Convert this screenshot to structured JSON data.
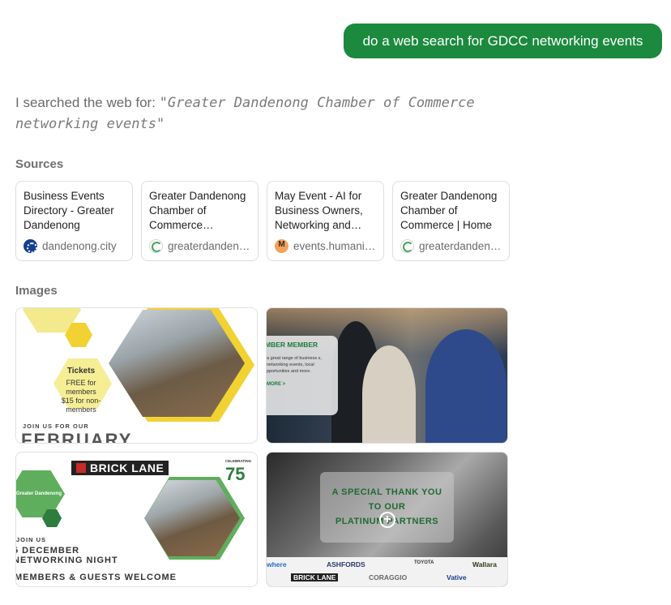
{
  "user_message": "do a web search for GDCC networking events",
  "search": {
    "prefix": "I searched the web for: ",
    "query": "\"Greater Dandenong Chamber of Commerce networking events\""
  },
  "sources": {
    "label": "Sources",
    "items": [
      {
        "title": "Business Events Directory - Greater Dandenong",
        "domain": "dandenong.city",
        "icon": "globe-icon"
      },
      {
        "title": "Greater Dandenong Chamber of Commerce…",
        "domain": "greaterdandenongchamber.com.au",
        "icon": "chamber-logo-icon"
      },
      {
        "title": "May Event - AI for Business Owners, Networking and…",
        "domain": "events.humanitix.com",
        "icon": "humanitix-icon"
      },
      {
        "title": "Greater Dandenong Chamber of Commerce | Home",
        "domain": "greaterdandenongchamber.com.au",
        "icon": "chamber-logo-icon"
      }
    ]
  },
  "images": {
    "label": "Images",
    "tiles": [
      {
        "tickets_title": "Tickets",
        "tickets_line1": "FREE for members",
        "tickets_line2": "$15 for non-members",
        "join": "JOIN US FOR OUR",
        "month": "FEBRUARY"
      },
      {
        "panel_title": "MBER MEMBER",
        "panel_text": "a great range of business s, networking events, local pportunities and more.",
        "panel_more": "MORE >"
      },
      {
        "brand": "BRICK LANE",
        "celebrating": "CELEBRATING",
        "anniversary": "75",
        "org": "Greater Dandenong",
        "join": "JOIN US",
        "date": "5 DECEMBER",
        "event": "NETWORKING NIGHT",
        "welcome": "MEMBERS & GUESTS WELCOME"
      },
      {
        "line1": "A SPECIAL THANK YOU",
        "line2": "TO OUR",
        "line3": "PLATINUM PARTNERS",
        "logos": [
          "where",
          "ASHFORDS",
          "TOYOTA",
          "Wallara",
          "BRICK LANE",
          "CORAGGIO",
          "Vative"
        ]
      }
    ]
  },
  "colors": {
    "bubble": "#1b8a3e",
    "text_muted": "#6b6b6b",
    "accent_green": "#2e7d3f",
    "accent_yellow": "#f2d232"
  }
}
